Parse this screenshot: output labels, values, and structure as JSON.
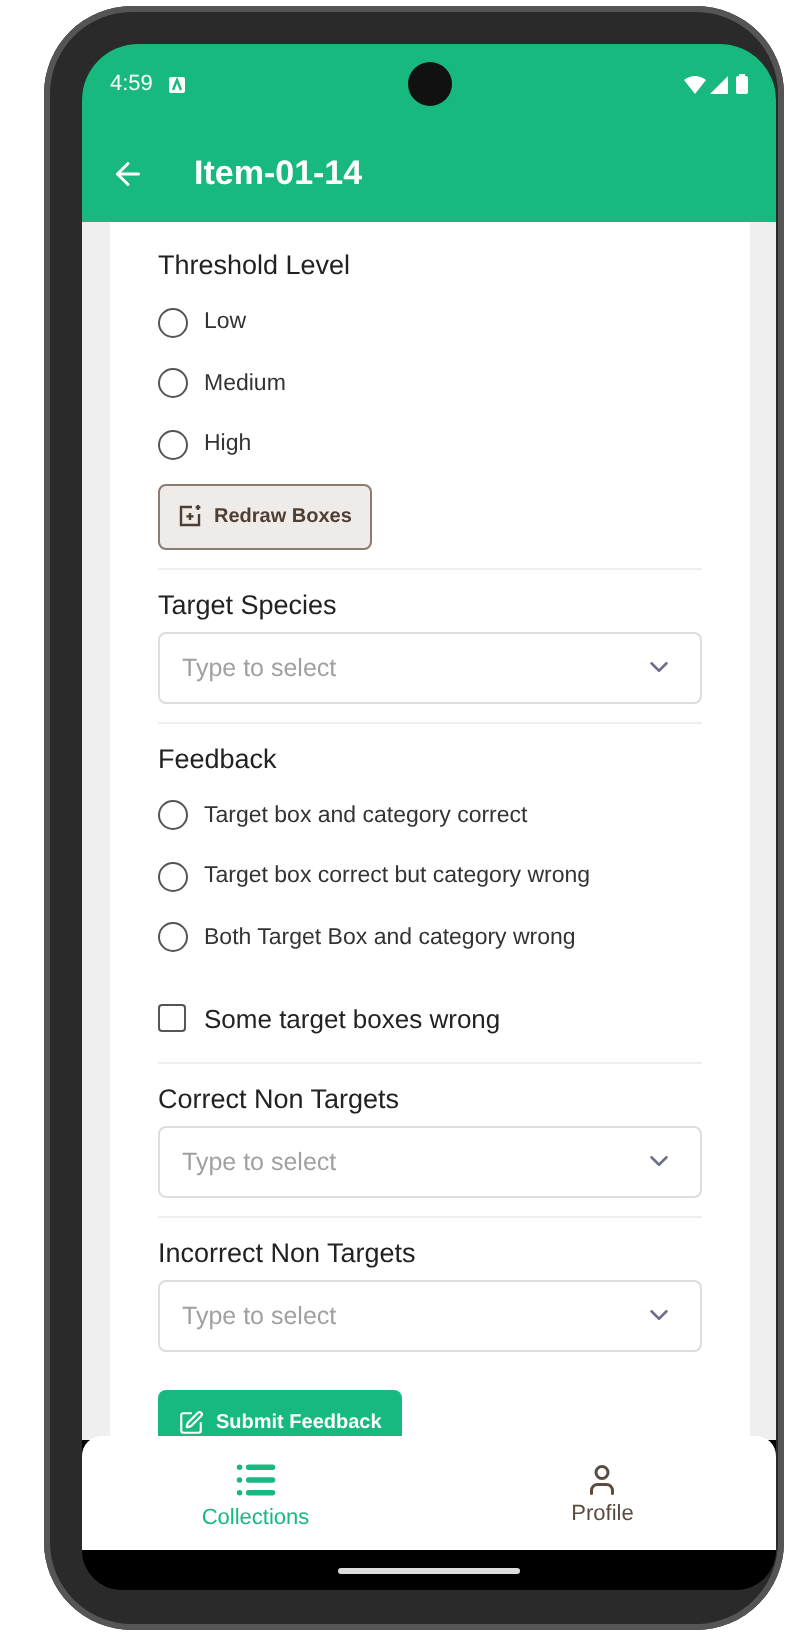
{
  "status_bar": {
    "time": "4:59"
  },
  "app_bar": {
    "title": "Item-01-14"
  },
  "threshold": {
    "label": "Threshold Level",
    "options": [
      {
        "label": "Low",
        "selected": false
      },
      {
        "label": "Medium",
        "selected": false
      },
      {
        "label": "High",
        "selected": false
      }
    ]
  },
  "redraw_button": "Redraw Boxes",
  "target_species": {
    "label": "Target Species",
    "placeholder": "Type to select"
  },
  "feedback": {
    "label": "Feedback",
    "options": [
      {
        "label": "Target box and category correct",
        "selected": false
      },
      {
        "label": "Target box correct but category wrong",
        "selected": false
      },
      {
        "label": "Both Target Box and category wrong",
        "selected": false
      }
    ],
    "checkbox": {
      "label": "Some target boxes wrong",
      "checked": false
    }
  },
  "correct_non_targets": {
    "label": "Correct Non Targets",
    "placeholder": "Type to select"
  },
  "incorrect_non_targets": {
    "label": "Incorrect Non Targets",
    "placeholder": "Type to select"
  },
  "submit_button": "Submit Feedback",
  "bottom_nav": [
    {
      "label": "Collections",
      "selected": true,
      "kind": "list"
    },
    {
      "label": "Profile",
      "selected": false,
      "kind": "person"
    }
  ]
}
